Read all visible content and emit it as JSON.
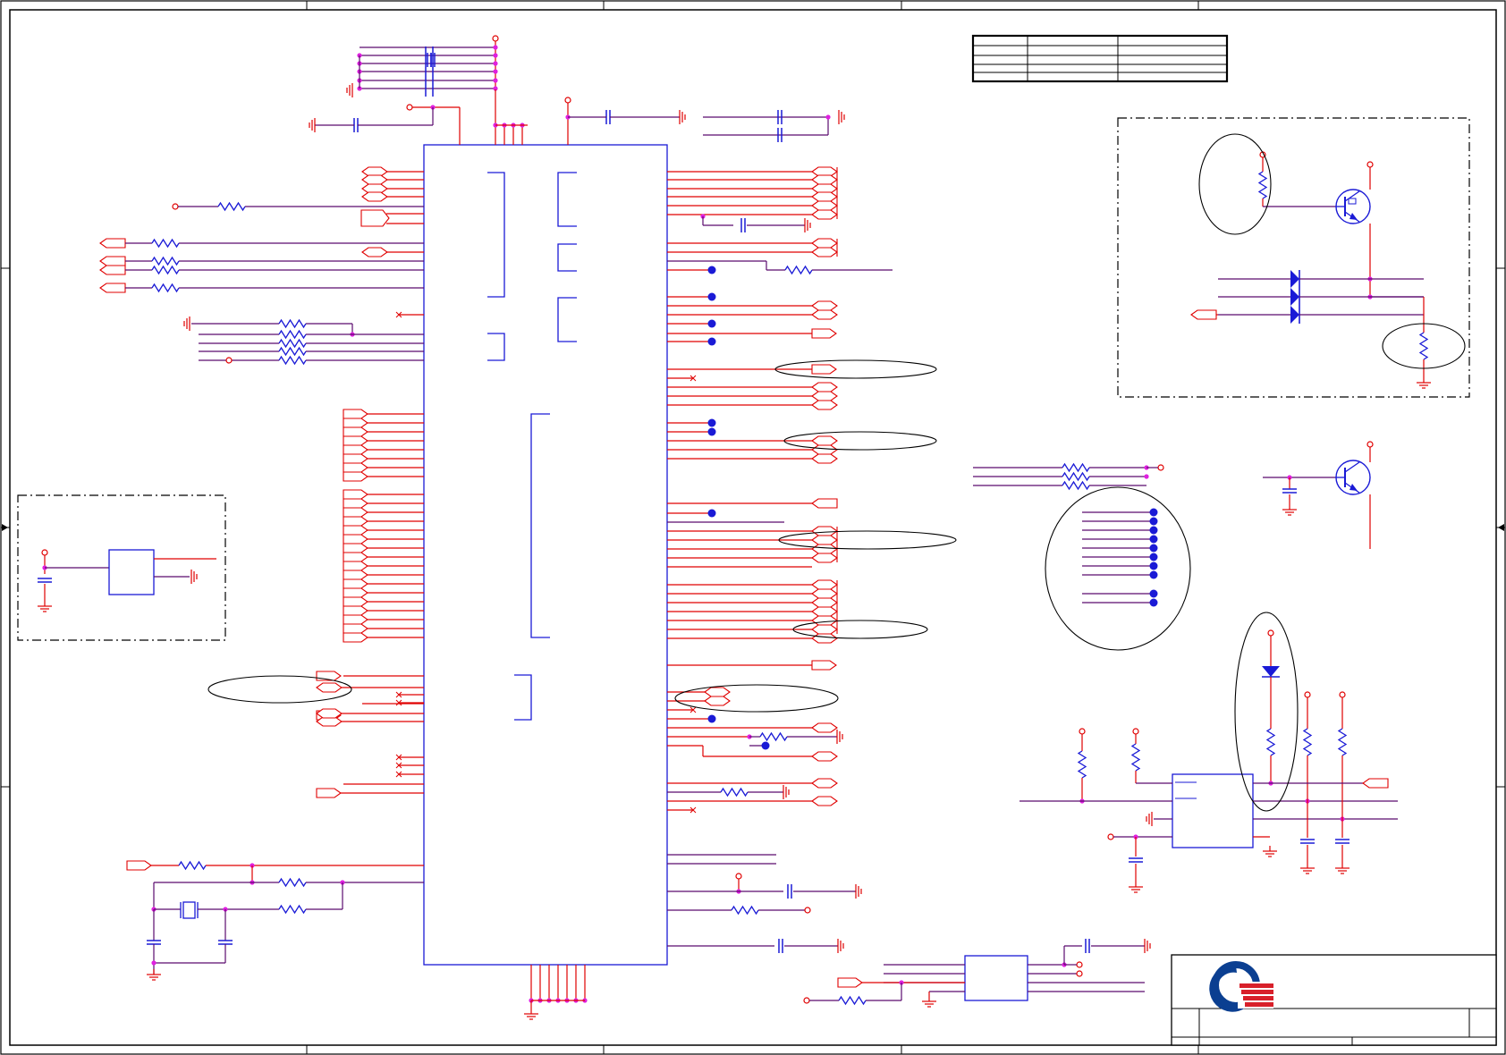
{
  "sheet": {
    "background": "#ffffff",
    "colors": {
      "frame": "#000000",
      "wire_red": "#e00000",
      "wire_purple": "#5a0a6e",
      "component_blue": "#1a1ad6",
      "junction": "#e020e0",
      "no_connect_dot": "#1a1ad6",
      "logo_blue": "#0b3f91",
      "logo_red": "#d8202a"
    },
    "elements": {
      "main_ic": "main-ic",
      "crystal": "crystal-oscillator",
      "revision_table": "revision-history-table",
      "title_block": "title-block",
      "company_logo": "company-logo-icon",
      "transistors": [
        "q-led-driver-1",
        "q-led-driver-2"
      ],
      "dashed_regions": [
        "led-indicator-region",
        "reset-circuit-region"
      ],
      "annotations": "review-ellipses"
    }
  }
}
